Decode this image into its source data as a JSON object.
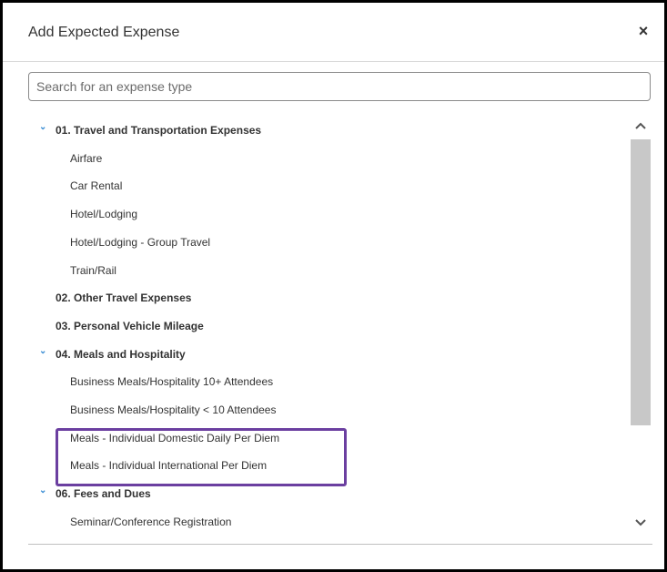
{
  "dialog": {
    "title": "Add Expected Expense",
    "close_label": "×"
  },
  "search": {
    "placeholder": "Search for an expense type",
    "value": ""
  },
  "list": {
    "items": [
      {
        "label": "01. Travel and Transportation Expenses",
        "kind": "category",
        "expanded": true
      },
      {
        "label": "Airfare",
        "kind": "item"
      },
      {
        "label": "Car Rental",
        "kind": "item"
      },
      {
        "label": "Hotel/Lodging",
        "kind": "item"
      },
      {
        "label": "Hotel/Lodging - Group Travel",
        "kind": "item"
      },
      {
        "label": "Train/Rail",
        "kind": "item"
      },
      {
        "label": "02. Other Travel Expenses",
        "kind": "category",
        "expanded": false
      },
      {
        "label": "03. Personal Vehicle Mileage",
        "kind": "category",
        "expanded": false
      },
      {
        "label": "04. Meals and Hospitality",
        "kind": "category",
        "expanded": true
      },
      {
        "label": "Business Meals/Hospitality 10+ Attendees",
        "kind": "item"
      },
      {
        "label": "Business Meals/Hospitality < 10 Attendees",
        "kind": "item"
      },
      {
        "label": "Meals - Individual Domestic Daily Per Diem",
        "kind": "item"
      },
      {
        "label": "Meals - Individual International Per Diem",
        "kind": "item"
      },
      {
        "label": "06. Fees and Dues",
        "kind": "category",
        "expanded": true
      },
      {
        "label": "Seminar/Conference Registration",
        "kind": "item"
      }
    ]
  },
  "icons": {
    "expanded_chevron": "⌄",
    "scroll_up": "^",
    "scroll_down": "⌄"
  },
  "colors": {
    "chevron": "#3a8dd4",
    "highlight_box": "#6b3fa0",
    "scroll_thumb": "#c8c8c8"
  }
}
